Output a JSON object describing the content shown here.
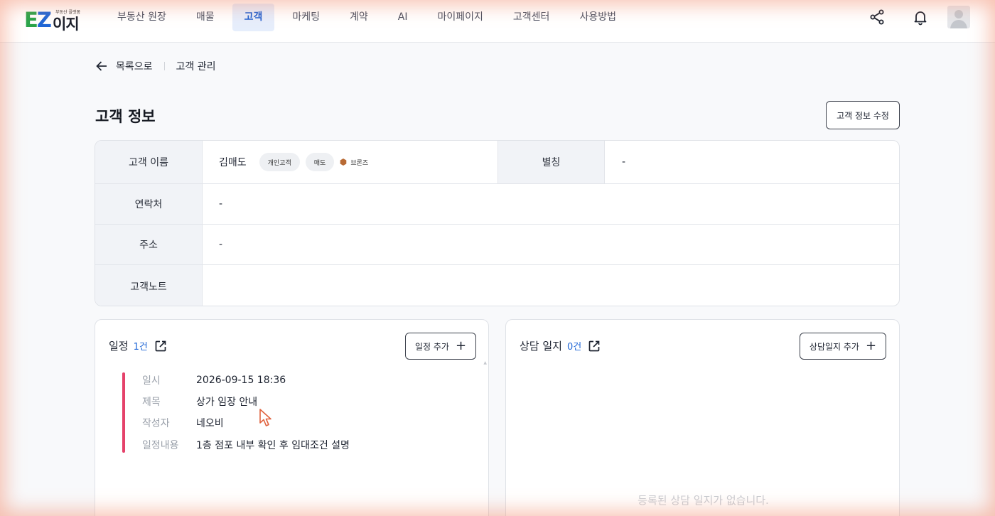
{
  "header": {
    "logo_small": "부동산 플랫폼",
    "logo_ez": "EZ",
    "logo_kr": "이지",
    "nav": [
      {
        "label": "부동산 원장"
      },
      {
        "label": "매물"
      },
      {
        "label": "고객",
        "active": true
      },
      {
        "label": "마케팅"
      },
      {
        "label": "계약"
      },
      {
        "label": "AI"
      },
      {
        "label": "마이페이지"
      },
      {
        "label": "고객센터"
      },
      {
        "label": "사용방법"
      }
    ],
    "icons": [
      "share-icon",
      "bell-icon",
      "avatar-icon"
    ]
  },
  "breadcrumb": {
    "back_label": "목록으로",
    "current": "고객 관리"
  },
  "page": {
    "title": "고객 정보",
    "edit_button": "고객 정보 수정"
  },
  "info": {
    "name_label": "고객 이름",
    "name_value": "김매도",
    "tags": [
      "개인고객",
      "매도"
    ],
    "grade": "브론즈",
    "grade_color": "#b86a34",
    "alias_label": "별칭",
    "alias_value": "-",
    "contact_label": "연락처",
    "contact_value": "-",
    "address_label": "주소",
    "address_value": "-",
    "note_label": "고객노트",
    "note_value": ""
  },
  "schedule": {
    "title": "일정",
    "count": "1건",
    "add_button": "일정 추가",
    "entry": {
      "color": "#e5426a",
      "date_label": "일시",
      "date_value": "2026-09-15 18:36",
      "subject_label": "제목",
      "subject_value": "상가 임장 안내",
      "author_label": "작성자",
      "author_value": "네오비",
      "content_label": "일정내용",
      "content_value": "1층 점포 내부 확인 후 임대조건 설명"
    }
  },
  "consult": {
    "title": "상담 일지",
    "count": "0건",
    "add_button": "상담일지 추가",
    "empty_text": "등록된 상담 일지가 없습니다."
  },
  "colors": {
    "accent": "#1f66d6",
    "nav_active_bg": "#e6eefc",
    "label_bg": "#f1f3f7"
  }
}
